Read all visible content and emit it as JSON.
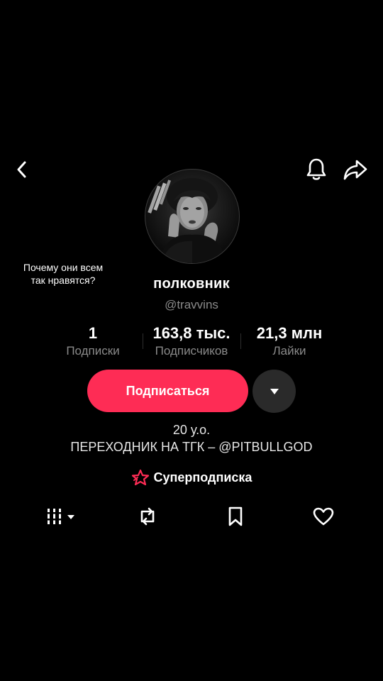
{
  "header": {
    "back_icon": "chevron-left-icon",
    "bell_icon": "bell-icon",
    "share_icon": "share-arrow-icon"
  },
  "note": {
    "line1": "Почему они всем",
    "line2": "так нравятся?"
  },
  "profile": {
    "display_name": "полковник",
    "username": "@travvins"
  },
  "stats": [
    {
      "value": "1",
      "label": "Подписки"
    },
    {
      "value": "163,8 тыс.",
      "label": "Подписчиков"
    },
    {
      "value": "21,3 млн",
      "label": "Лайки"
    }
  ],
  "actions": {
    "follow_label": "Подписаться",
    "dropdown_icon": "caret-down-icon"
  },
  "bio": {
    "line1": "20 у.о.",
    "line2": "ПЕРЕХОДНИК НА ТГК – @PITBULLGOD"
  },
  "super_subscription": {
    "label": "Суперподписка",
    "icon": "star-badge-icon"
  },
  "tabs": [
    {
      "icon": "grid-icon"
    },
    {
      "icon": "repost-icon"
    },
    {
      "icon": "bookmark-icon"
    },
    {
      "icon": "heart-icon"
    }
  ],
  "colors": {
    "accent": "#fe2c55",
    "background": "#000000",
    "secondary_text": "#8a8a8a"
  }
}
